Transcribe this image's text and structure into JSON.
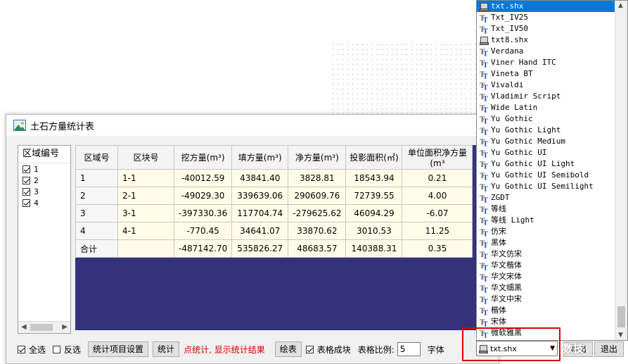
{
  "window": {
    "title": "土石方量统计表"
  },
  "region_panel": {
    "header": "区域编号",
    "items": [
      "1",
      "2",
      "3",
      "4"
    ]
  },
  "table": {
    "columns": [
      "区域号",
      "区块号",
      "挖方量(m³)",
      "填方量(m³)",
      "净方量(m³)",
      "投影面积(㎡)",
      "单位面积净方量(m³"
    ],
    "rows": [
      [
        "1",
        "1-1",
        "-40012.59",
        "43841.40",
        "3828.81",
        "18543.94",
        "0.21"
      ],
      [
        "2",
        "2-1",
        "-49029.30",
        "339639.06",
        "290609.76",
        "72739.55",
        "4.00"
      ],
      [
        "3",
        "3-1",
        "-397330.36",
        "117704.74",
        "-279625.62",
        "46094.29",
        "-6.07"
      ],
      [
        "4",
        "4-1",
        "-770.45",
        "34641.07",
        "33870.62",
        "3010.53",
        "11.25"
      ],
      [
        "合计",
        "",
        "-487142.70",
        "535826.27",
        "48683.57",
        "140388.31",
        "0.35"
      ]
    ]
  },
  "bottom": {
    "select_all": "全选",
    "invert": "反选",
    "settings_button": "统计项目设置",
    "stats_button": "统计",
    "hint": "点统计, 显示统计结果",
    "draw_button": "绘表",
    "table_block": "表格成块",
    "scale_label": "表格比例:",
    "scale_value": "5",
    "font_label": "字体",
    "export_button": "导出",
    "exit_button": "退出"
  },
  "font_dropdown": {
    "selected": "txt.shx",
    "items": [
      {
        "name": "txt.shx",
        "type": "shx"
      },
      {
        "name": "Txt_IV25",
        "type": "tt"
      },
      {
        "name": "Txt_IV50",
        "type": "tt"
      },
      {
        "name": "txt8.shx",
        "type": "shx"
      },
      {
        "name": "Verdana",
        "type": "tt"
      },
      {
        "name": "Viner Hand ITC",
        "type": "tt"
      },
      {
        "name": "Vineta BT",
        "type": "tt"
      },
      {
        "name": "Vivaldi",
        "type": "tt"
      },
      {
        "name": "Vladimir Script",
        "type": "tt"
      },
      {
        "name": "Wide Latin",
        "type": "tt"
      },
      {
        "name": "Yu Gothic",
        "type": "tt"
      },
      {
        "name": "Yu Gothic Light",
        "type": "tt"
      },
      {
        "name": "Yu Gothic Medium",
        "type": "tt"
      },
      {
        "name": "Yu Gothic UI",
        "type": "tt"
      },
      {
        "name": "Yu Gothic UI Light",
        "type": "tt"
      },
      {
        "name": "Yu Gothic UI Semibold",
        "type": "tt"
      },
      {
        "name": "Yu Gothic UI Semilight",
        "type": "tt"
      },
      {
        "name": "ZGDT",
        "type": "tt"
      },
      {
        "name": "等线",
        "type": "tt"
      },
      {
        "name": "等线 Light",
        "type": "tt"
      },
      {
        "name": "仿宋",
        "type": "tt"
      },
      {
        "name": "黑体",
        "type": "tt"
      },
      {
        "name": "华文仿宋",
        "type": "tt"
      },
      {
        "name": "华文楷体",
        "type": "tt"
      },
      {
        "name": "华文宋体",
        "type": "tt"
      },
      {
        "name": "华文细黑",
        "type": "tt"
      },
      {
        "name": "华文中宋",
        "type": "tt"
      },
      {
        "name": "楷体",
        "type": "tt"
      },
      {
        "name": "宋体",
        "type": "tt"
      },
      {
        "name": "微软雅黑",
        "type": "tt"
      }
    ]
  },
  "combo_value": "txt.shx",
  "watermark": "数技",
  "colors": {
    "table_bg": "#34327a",
    "selection": "#0078d7",
    "hint_red": "#d60000",
    "highlight_red": "#e00000",
    "cell_yellow": "#fffde8"
  }
}
